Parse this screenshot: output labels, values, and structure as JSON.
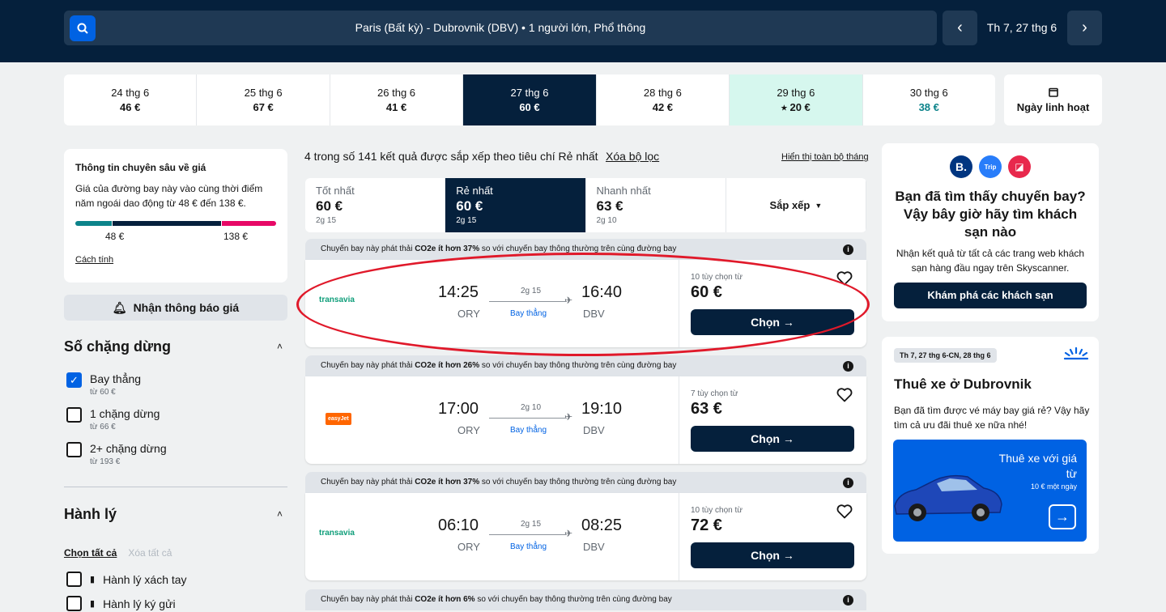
{
  "header": {
    "search_summary": "Paris (Bất kỳ) - Dubrovnik (DBV)  •  1 người lớn, Phổ thông",
    "date": "Th 7, 27 thg 6",
    "prev_icon": "chevron-left-icon",
    "next_icon": "chevron-right-icon"
  },
  "date_strip": [
    {
      "date": "24 thg 6",
      "price": "46 €"
    },
    {
      "date": "25 thg 6",
      "price": "67 €"
    },
    {
      "date": "26 thg 6",
      "price": "41 €"
    },
    {
      "date": "27 thg 6",
      "price": "60 €",
      "selected": true
    },
    {
      "date": "28 thg 6",
      "price": "42 €"
    },
    {
      "date": "29 thg 6",
      "price": "⭑ 20 €",
      "cheapest": true
    },
    {
      "date": "30 thg 6",
      "price": "38 €",
      "green": true
    }
  ],
  "flexible_date": "Ngày linh hoạt",
  "insight": {
    "title": "Thông tin chuyên sâu về giá",
    "text": "Giá của đường bay này vào cùng thời điểm năm ngoái dao động từ 48 € đến 138 €.",
    "low": "48 €",
    "high": "138 €",
    "how": "Cách tính",
    "colors": [
      "#0c838a",
      "#05203c",
      "#e70866"
    ]
  },
  "alert_button": "Nhận thông báo giá",
  "stops": {
    "title": "Số chặng dừng",
    "options": [
      {
        "label": "Bay thẳng",
        "sub": "từ 60 €",
        "checked": true
      },
      {
        "label": "1 chặng dừng",
        "sub": "từ 66 €",
        "checked": false
      },
      {
        "label": "2+ chặng dừng",
        "sub": "từ 193 €",
        "checked": false
      }
    ]
  },
  "baggage": {
    "title": "Hành lý",
    "select_all": "Chọn tất cả",
    "clear_all": "Xóa tất cả",
    "options": [
      "Hành lý xách tay",
      "Hành lý ký gửi"
    ]
  },
  "results": {
    "count_text": "4 trong số 141 kết quả được sắp xếp theo tiêu chí Rẻ nhất",
    "clear_filters": "Xóa bộ lọc",
    "show_month": "Hiển thị toàn bộ tháng"
  },
  "sort_tabs": [
    {
      "title": "Tốt nhất",
      "price": "60 €",
      "duration": "2g 15"
    },
    {
      "title": "Rẻ nhất",
      "price": "60 €",
      "duration": "2g 15",
      "active": true
    },
    {
      "title": "Nhanh nhất",
      "price": "63 €",
      "duration": "2g 10"
    }
  ],
  "sort_label": "Sắp xếp",
  "flights": [
    {
      "eco_pre": "Chuyến bay này phát thải ",
      "eco_bold": "CO2e ít hơn 37%",
      "eco_post": " so với chuyến bay thông thường trên cùng đường bay",
      "airline": "transavia",
      "dep": "14:25",
      "dep_ap": "ORY",
      "arr": "16:40",
      "arr_ap": "DBV",
      "duration": "2g 15",
      "type": "Bay thẳng",
      "deals": "10 tùy chọn từ",
      "price": "60 €",
      "select": "Chọn →"
    },
    {
      "eco_pre": "Chuyến bay này phát thải ",
      "eco_bold": "CO2e ít hơn 26%",
      "eco_post": " so với chuyến bay thông thường trên cùng đường bay",
      "airline": "easyJet",
      "dep": "17:00",
      "dep_ap": "ORY",
      "arr": "19:10",
      "arr_ap": "DBV",
      "duration": "2g 10",
      "type": "Bay thẳng",
      "deals": "7 tùy chọn từ",
      "price": "63 €",
      "select": "Chọn →"
    },
    {
      "eco_pre": "Chuyến bay này phát thải ",
      "eco_bold": "CO2e ít hơn 37%",
      "eco_post": " so với chuyến bay thông thường trên cùng đường bay",
      "airline": "transavia",
      "dep": "06:10",
      "dep_ap": "ORY",
      "arr": "08:25",
      "arr_ap": "DBV",
      "duration": "2g 15",
      "type": "Bay thẳng",
      "deals": "10 tùy chọn từ",
      "price": "72 €",
      "select": "Chọn →"
    },
    {
      "eco_pre": "Chuyến bay này phát thải ",
      "eco_bold": "CO2e ít hơn 6%",
      "eco_post": " so với chuyến bay thông thường trên cùng đường bay"
    }
  ],
  "hotel_ad": {
    "logos": [
      "B.",
      "Trip",
      "◪"
    ],
    "title": "Bạn đã tìm thấy chuyến bay? Vậy bây giờ hãy tìm khách sạn nào",
    "text": "Nhận kết quả từ tất cả các trang web khách sạn hàng đầu ngay trên Skyscanner.",
    "button": "Khám phá các khách sạn"
  },
  "car_ad": {
    "dates": "Th 7, 27 thg 6-CN, 28 thg 6",
    "title": "Thuê xe ở Dubrovnik",
    "text": "Bạn đã tìm được vé máy bay giá rẻ? Vậy hãy tìm cả ưu đãi thuê xe nữa nhé!",
    "promo_title": "Thuê xe với giá từ",
    "promo_price": "10 € một ngày",
    "arrow": "→"
  }
}
